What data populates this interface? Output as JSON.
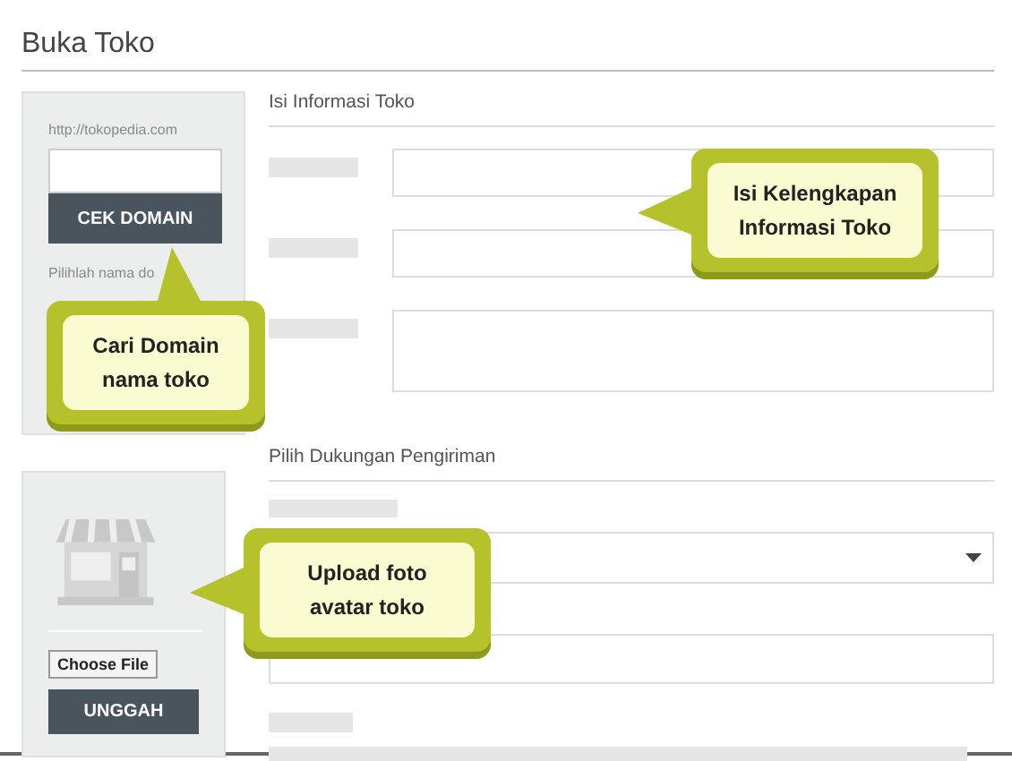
{
  "page": {
    "title": "Buka Toko"
  },
  "domain_panel": {
    "prefix": "http://tokopedia.com",
    "button": "CEK DOMAIN",
    "hint": "Pilihlah nama do"
  },
  "info_section": {
    "title": "Isi Informasi Toko",
    "fields": [
      {
        "kind": "input"
      },
      {
        "kind": "input"
      },
      {
        "kind": "textarea"
      }
    ]
  },
  "shipping_section": {
    "title": "Pilih Dukungan Pengiriman",
    "fields": [
      {
        "kind": "label"
      },
      {
        "kind": "select"
      },
      {
        "kind": "input"
      },
      {
        "kind": "label"
      },
      {
        "kind": "bar"
      }
    ]
  },
  "avatar_panel": {
    "file_button": "Choose File",
    "button": "UNGGAH"
  },
  "callouts": [
    {
      "text": "Cari Domain nama toko",
      "kind": "top"
    },
    {
      "text": "Isi Kelengkapan Informasi Toko",
      "kind": "side"
    },
    {
      "text": "Upload foto avatar toko",
      "kind": "side"
    }
  ]
}
